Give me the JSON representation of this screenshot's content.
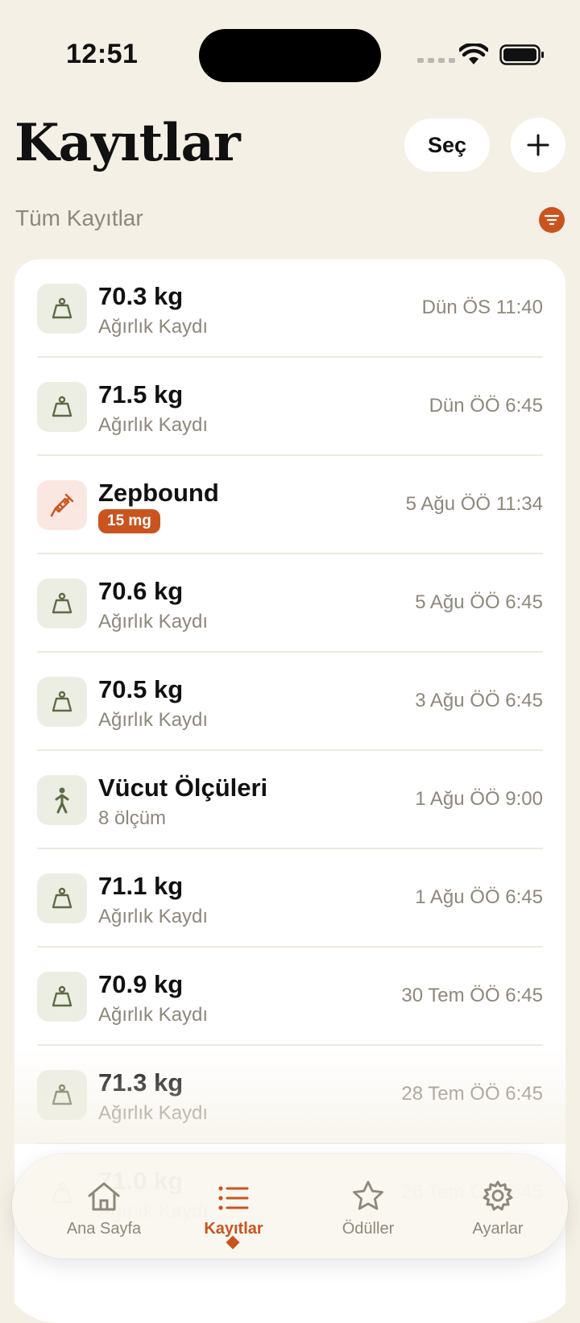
{
  "status_bar": {
    "time": "12:51"
  },
  "header": {
    "title": "Kayıtlar",
    "select_label": "Seç",
    "filter_label": "Tüm Kayıtlar"
  },
  "entries": [
    {
      "icon": "scale-icon",
      "title": "70.3 kg",
      "subtitle": "Ağırlık Kaydı",
      "time": "Dün ÖS 11:40"
    },
    {
      "icon": "scale-icon",
      "title": "71.5 kg",
      "subtitle": "Ağırlık Kaydı",
      "time": "Dün ÖÖ 6:45"
    },
    {
      "icon": "syringe-icon",
      "title": "Zepbound",
      "badge": "15 mg",
      "time": "5 Ağu ÖÖ 11:34"
    },
    {
      "icon": "scale-icon",
      "title": "70.6 kg",
      "subtitle": "Ağırlık Kaydı",
      "time": "5 Ağu ÖÖ 6:45"
    },
    {
      "icon": "scale-icon",
      "title": "70.5 kg",
      "subtitle": "Ağırlık Kaydı",
      "time": "3 Ağu ÖÖ 6:45"
    },
    {
      "icon": "person-icon",
      "title": "Vücut Ölçüleri",
      "subtitle": "8 ölçüm",
      "time": "1 Ağu ÖÖ 9:00"
    },
    {
      "icon": "scale-icon",
      "title": "71.1 kg",
      "subtitle": "Ağırlık Kaydı",
      "time": "1 Ağu ÖÖ 6:45"
    },
    {
      "icon": "scale-icon",
      "title": "70.9 kg",
      "subtitle": "Ağırlık Kaydı",
      "time": "30 Tem ÖÖ 6:45"
    },
    {
      "icon": "scale-icon",
      "title": "71.3 kg",
      "subtitle": "Ağırlık Kaydı",
      "time": "28 Tem ÖÖ 6:45"
    },
    {
      "icon": "scale-icon",
      "title": "71.0 kg",
      "subtitle": "Ağırlık Kaydı",
      "time": "26 Tem ÖÖ 6:45"
    }
  ],
  "tabs": [
    {
      "label": "Ana Sayfa",
      "icon": "house-icon",
      "active": false
    },
    {
      "label": "Kayıtlar",
      "icon": "list-icon",
      "active": true
    },
    {
      "label": "Ödüller",
      "icon": "star-icon",
      "active": false
    },
    {
      "label": "Ayarlar",
      "icon": "gear-icon",
      "active": false
    }
  ],
  "colors": {
    "accent": "#c9541e",
    "background": "#f5f0e6",
    "icon_green": "#5e6a45",
    "muted_text": "#8e877b"
  }
}
